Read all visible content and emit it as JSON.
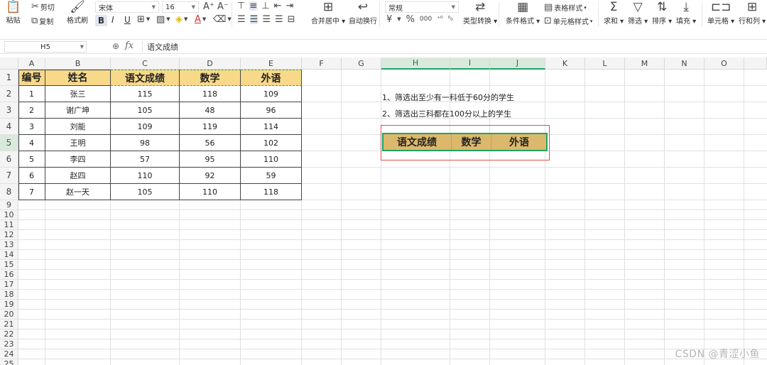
{
  "ribbon": {
    "paste": "粘贴",
    "cut": "剪切",
    "copy": "复制",
    "format_painter": "格式刷",
    "font_name": "宋体",
    "font_size": "16",
    "bold": "B",
    "italic": "I",
    "underline": "U",
    "merge_center": "合并居中",
    "auto_wrap": "自动换行",
    "number_format": "常规",
    "currency": "¥",
    "percent": "%",
    "thousands": "000",
    "type_convert": "类型转换",
    "cond_format": "条件格式",
    "table_style": "表格样式",
    "cell_style": "单元格样式",
    "sum": "求和",
    "filter": "筛选",
    "sort": "排序",
    "fill": "填充",
    "cells": "单元格",
    "rows_cols": "行和列"
  },
  "formula_bar": {
    "name_box": "H5",
    "fx": "fx",
    "content": "语文成绩"
  },
  "columns": [
    "A",
    "B",
    "C",
    "D",
    "E",
    "F",
    "G",
    "H",
    "I",
    "J",
    "K",
    "L",
    "M",
    "N",
    "O"
  ],
  "rows": [
    "1",
    "2",
    "3",
    "4",
    "5",
    "6",
    "7",
    "8",
    "9",
    "10",
    "11",
    "12",
    "13",
    "14",
    "15",
    "16",
    "17",
    "18",
    "19",
    "20",
    "21",
    "22",
    "23",
    "24",
    "25"
  ],
  "table": {
    "headers": [
      "编号",
      "姓名",
      "语文成绩",
      "数学",
      "外语"
    ],
    "rows": [
      [
        "1",
        "张三",
        "115",
        "118",
        "109"
      ],
      [
        "2",
        "谢广坤",
        "105",
        "48",
        "96"
      ],
      [
        "3",
        "刘能",
        "109",
        "119",
        "114"
      ],
      [
        "4",
        "王明",
        "98",
        "56",
        "102"
      ],
      [
        "5",
        "李四",
        "57",
        "95",
        "110"
      ],
      [
        "6",
        "赵四",
        "110",
        "92",
        "59"
      ],
      [
        "7",
        "赵一天",
        "105",
        "110",
        "118"
      ]
    ]
  },
  "notes": [
    "1、筛选出至少有一科低于60分的学生",
    "2、筛选出三科都在100分以上的学生"
  ],
  "criteria": [
    "语文成绩",
    "数学",
    "外语"
  ],
  "watermark": "CSDN @青涩小鱼",
  "colors": {
    "header_fill": "#f8d98a",
    "criteria_fill": "#dcb86c",
    "selection": "#21a366",
    "criteria_outline": "#e05050"
  }
}
